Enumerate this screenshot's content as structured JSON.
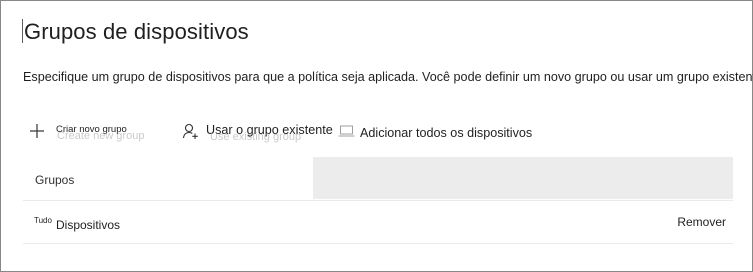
{
  "panel": {
    "title": "Grupos de dispositivos",
    "description": "Especifique um grupo de dispositivos para que a política seja aplicada. Você pode definir um novo grupo ou usar um grupo existente."
  },
  "toolbar": {
    "create_group_label": "Criar novo grupo",
    "create_group_ghost": "Create new group",
    "use_existing_label": "Usar o grupo existente",
    "use_existing_ghost": "Use existing group",
    "add_all_devices_label": "Adicionar todos os dispositivos",
    "icons": {
      "create": "plus-icon",
      "use_existing": "add-person-icon",
      "add_all": "laptop-icon"
    }
  },
  "table": {
    "header": {
      "groups": "Grupos"
    },
    "rows": [
      {
        "tag": "Tudo",
        "name": "Dispositivos",
        "action": "Remover"
      }
    ]
  },
  "colors": {
    "header_fill": "#ececec",
    "border": "#8a8886",
    "text": "#201f1e"
  }
}
